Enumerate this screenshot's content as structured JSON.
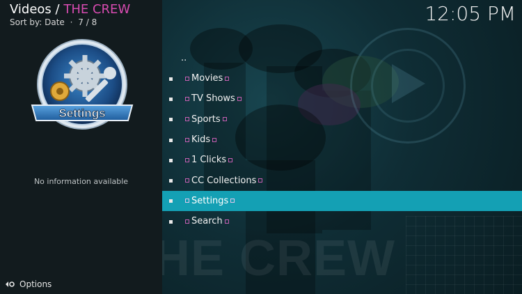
{
  "header": {
    "section": "Videos",
    "separator": " / ",
    "addon": "THE CREW",
    "sort_label": "Sort by: Date",
    "dot": "·",
    "position": "7 / 8"
  },
  "clock": "12:05 PM",
  "info_panel": {
    "thumbnail_label": "Settings",
    "no_info": "No information available"
  },
  "footer": {
    "options_label": "Options"
  },
  "list": {
    "parent": "..",
    "items": [
      {
        "label": "Movies",
        "selected": false
      },
      {
        "label": "TV Shows",
        "selected": false
      },
      {
        "label": "Sports",
        "selected": false
      },
      {
        "label": "Kids",
        "selected": false
      },
      {
        "label": "1 Clicks",
        "selected": false
      },
      {
        "label": "CC Collections",
        "selected": false
      },
      {
        "label": "Settings",
        "selected": true
      },
      {
        "label": "Search",
        "selected": false
      }
    ]
  },
  "background": {
    "brand_text": "HE CREW"
  },
  "colors": {
    "accent_addon": "#d74bb0",
    "selection": "#14a0b4",
    "left_pane": "#121b1e"
  }
}
